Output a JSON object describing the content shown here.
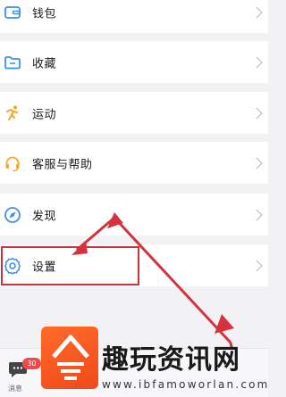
{
  "menu": {
    "items": [
      {
        "label": "钱包",
        "icon": "wallet-icon"
      },
      {
        "label": "收藏",
        "icon": "folder-icon"
      },
      {
        "label": "运动",
        "icon": "running-icon"
      },
      {
        "label": "客服与帮助",
        "icon": "headset-icon"
      },
      {
        "label": "发现",
        "icon": "compass-icon"
      },
      {
        "label": "设置",
        "icon": "gear-icon"
      }
    ]
  },
  "bottom_nav": {
    "messages": {
      "label": "消息",
      "badge": "30",
      "icon": "chat-bubble-icon"
    }
  },
  "watermark": {
    "title": "趣玩资讯网",
    "url": "www.ibfamoworlan.com",
    "logo": "site-logo-icon"
  },
  "colors": {
    "accent_blue": "#3d8ff0",
    "sport_orange": "#f5a623",
    "headset_orange": "#f5a623",
    "highlight_red": "#c8333c",
    "badge_red": "#f04b4b",
    "logo_orange": "#f04a1a"
  }
}
